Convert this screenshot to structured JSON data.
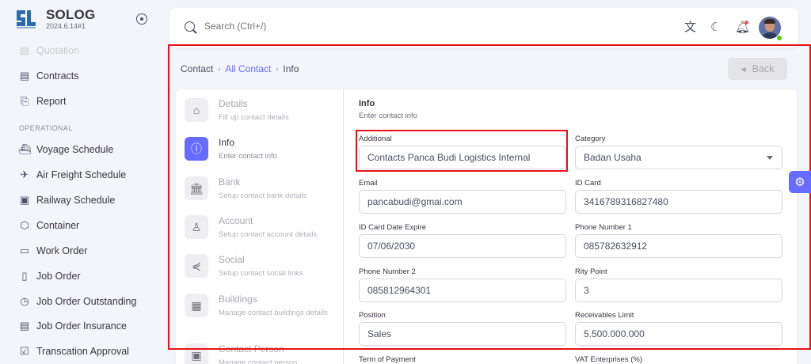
{
  "brand": {
    "name": "SOLOG",
    "version": "2024.6.14#1",
    "logo_sub": "SLG"
  },
  "sidebar": {
    "section_operational": "OPERATIONAL",
    "items": [
      {
        "label": "Quotation",
        "icon": "quotation-icon"
      },
      {
        "label": "Contracts",
        "icon": "contracts-icon"
      },
      {
        "label": "Report",
        "icon": "report-icon"
      },
      {
        "label": "Voyage Schedule",
        "icon": "ship-icon"
      },
      {
        "label": "Air Freight Schedule",
        "icon": "plane-icon"
      },
      {
        "label": "Railway Schedule",
        "icon": "train-icon"
      },
      {
        "label": "Container",
        "icon": "container-icon"
      },
      {
        "label": "Work Order",
        "icon": "folder-icon"
      },
      {
        "label": "Job Order",
        "icon": "file-icon"
      },
      {
        "label": "Job Order Outstanding",
        "icon": "file-clock-icon"
      },
      {
        "label": "Job Order Insurance",
        "icon": "file-text-icon"
      },
      {
        "label": "Transcation Approval",
        "icon": "approval-icon"
      }
    ]
  },
  "header": {
    "search_placeholder": "Search (Ctrl+/)"
  },
  "breadcrumb": {
    "root": "Contact",
    "parent": "All Contact",
    "current": "Info"
  },
  "back_button": "Back",
  "steps": [
    {
      "title": "Details",
      "sub": "Fill up contact details"
    },
    {
      "title": "Info",
      "sub": "Enter contact info"
    },
    {
      "title": "Bank",
      "sub": "Setup contact bank details"
    },
    {
      "title": "Account",
      "sub": "Setup contact account details"
    },
    {
      "title": "Social",
      "sub": "Setup contact social links"
    },
    {
      "title": "Buildings",
      "sub": "Manage contact buildings details"
    },
    {
      "title": "Contact Person",
      "sub": "Manage contact person"
    }
  ],
  "form": {
    "title": "Info",
    "subtitle": "Enter contact info",
    "additional": {
      "label": "Additional",
      "value": "Contacts Panca Budi Logistics Internal"
    },
    "category": {
      "label": "Category",
      "value": "Badan Usaha"
    },
    "email": {
      "label": "Email",
      "value": "pancabudi@gmai.com"
    },
    "id_card": {
      "label": "ID Card",
      "value": "3416789316827480"
    },
    "id_expire": {
      "label": "ID Card Date Expire",
      "value": "07/06/2030"
    },
    "phone1": {
      "label": "Phone Number 1",
      "value": "085782632912"
    },
    "phone2": {
      "label": "Phone Number 2",
      "value": "085812964301"
    },
    "rity_point": {
      "label": "Rity Point",
      "value": "3"
    },
    "position": {
      "label": "Position",
      "value": "Sales"
    },
    "receivables": {
      "label": "Receivables Limit",
      "value": "5.500.000.000"
    },
    "term_payment": {
      "label": "Term of Payment"
    },
    "vat": {
      "label": "VAT Enterprises (%)"
    }
  },
  "colors": {
    "accent": "#666cff",
    "highlight": "#e8111a"
  }
}
